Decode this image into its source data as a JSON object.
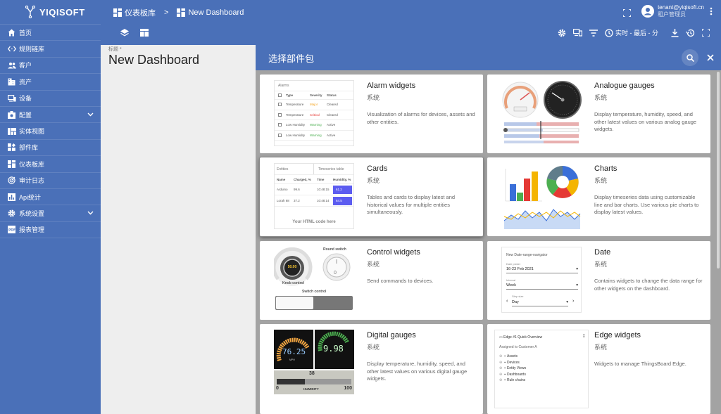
{
  "app": {
    "brand": "YIQISOFT"
  },
  "sidebar": {
    "items": [
      {
        "label": "首页",
        "icon": "home-icon"
      },
      {
        "label": "规则链库",
        "icon": "code-icon"
      },
      {
        "label": "客户",
        "icon": "people-icon"
      },
      {
        "label": "资产",
        "icon": "domain-icon"
      },
      {
        "label": "设备",
        "icon": "devices-icon"
      },
      {
        "label": "配置",
        "icon": "settings-box-icon",
        "expandable": true
      },
      {
        "label": "实体视图",
        "icon": "view-quilt-icon"
      },
      {
        "label": "部件库",
        "icon": "widgets-icon"
      },
      {
        "label": "仪表板库",
        "icon": "dashboards-icon"
      },
      {
        "label": "审计日志",
        "icon": "track-changes-icon"
      },
      {
        "label": "Api统计",
        "icon": "insert-chart-icon"
      },
      {
        "label": "系统设置",
        "icon": "gear-icon",
        "expandable": true
      },
      {
        "label": "报表管理",
        "icon": "pdf-icon"
      }
    ]
  },
  "header": {
    "breadcrumb": {
      "parent": "仪表板库",
      "separator": ">",
      "current": "New Dashboard"
    },
    "user": {
      "email": "tenant@yiqisoft.cn",
      "role": "租户管理员"
    },
    "timewindow": "实时 - 最后 - 分"
  },
  "dashboard": {
    "title_label": "标题 *",
    "title": "New Dashboard"
  },
  "panel": {
    "title": "选择部件包",
    "cards": [
      {
        "name": "Alarm widgets",
        "sys": "系统",
        "desc": "Visualization of alarms for devices, assets and other entities."
      },
      {
        "name": "Analogue gauges",
        "sys": "系统",
        "desc": "Display temperature, humidity, speed, and other latest values on various analog gauge widgets."
      },
      {
        "name": "Cards",
        "sys": "系统",
        "desc": "Tables and cards to display latest and historical values for multiple entities simultaneously."
      },
      {
        "name": "Charts",
        "sys": "系统",
        "desc": "Display timeseries data using customizable line and bar charts. Use various pie charts to display latest values."
      },
      {
        "name": "Control widgets",
        "sys": "系统",
        "desc": "Send commands to devices."
      },
      {
        "name": "Date",
        "sys": "系统",
        "desc": "Contains widgets to change the data range for other widgets on the dashboard."
      },
      {
        "name": "Digital gauges",
        "sys": "系统",
        "desc": "Display temperature, humidity, speed, and other latest values on various digital gauge widgets."
      },
      {
        "name": "Edge widgets",
        "sys": "系统",
        "desc": "Widgets to manage ThingsBoard Edge."
      }
    ],
    "previews": {
      "alarms": {
        "title": "Alarms",
        "headers": [
          "Type",
          "Severity",
          "Status"
        ],
        "rows": [
          [
            "Temperature",
            "Major",
            "Cleared"
          ],
          [
            "Temperature",
            "Critical",
            "Cleared"
          ],
          [
            "Low Humidity",
            "Warning",
            "Active"
          ],
          [
            "Low Humidity",
            "Warning",
            "Active"
          ]
        ]
      },
      "cards": {
        "entities": "Entities",
        "timeseries": "Timeseries table",
        "ent_headers": [
          "Name",
          "Charged, %"
        ],
        "ts_headers": [
          "Time",
          "Humidity, %"
        ],
        "rows": [
          [
            "Arduino",
            "99.6",
            "10:48:15",
            "61.2"
          ],
          [
            "Lorah 68",
            "37.2",
            "10:48:14",
            "64.5"
          ]
        ],
        "html": "Your HTML code here"
      },
      "control": {
        "round": "Round switch",
        "knob": "Knob control",
        "switch": "Switch control",
        "knob_value": "50.00",
        "round_value": "0"
      },
      "date": {
        "title": "New Date-range-navigator",
        "date_picker_label": "Date picker",
        "date_picker_value": "16-23 Feb 2021",
        "interval_label": "Interval",
        "interval_value": "Week",
        "step_label": "Step size",
        "step_value": "Day"
      },
      "digital": {
        "value1": "76.25",
        "unit1": "MPH",
        "value2": "9.98",
        "hum_value": "38",
        "hum_min": "0",
        "hum_max": "100",
        "hum_label": "HUMIDITY"
      },
      "edge": {
        "title": "Edge #1 Quick Overview",
        "assigned": "Assigned to Customer A",
        "items": [
          "Assets",
          "Devices",
          "Entity Views",
          "Dashboards",
          "Rule chains"
        ]
      }
    }
  },
  "colors": {
    "primary": "#4a70b8",
    "accent_blue": "#305680"
  }
}
